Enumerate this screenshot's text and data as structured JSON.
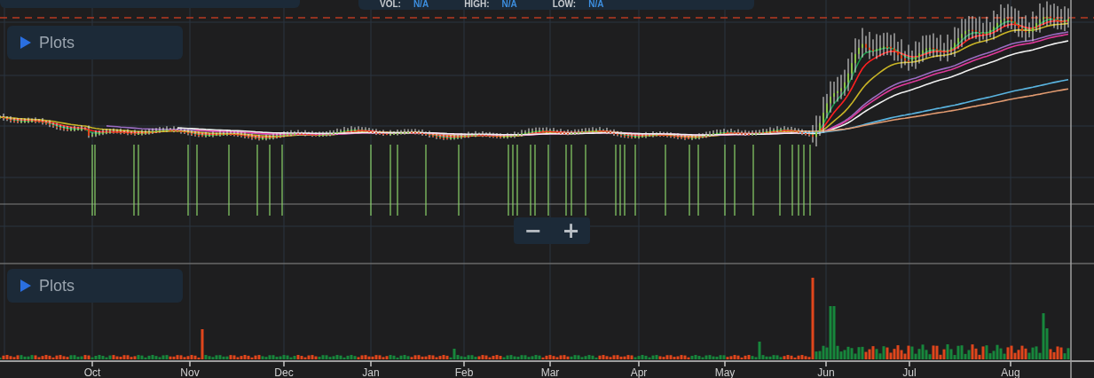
{
  "header": {
    "stats": [
      {
        "label": "VOL:",
        "value": "N/A"
      },
      {
        "label": "HIGH:",
        "value": "N/A"
      },
      {
        "label": "LOW:",
        "value": "N/A"
      }
    ]
  },
  "price_panel": {
    "plots_button": {
      "label": "Plots"
    },
    "zoom_controls": [
      {
        "label": "−"
      },
      {
        "label": "+"
      }
    ]
  },
  "volume_panel": {
    "plots_button": {
      "label": "Plots"
    }
  },
  "x_axis": {
    "labels": [
      "Oct",
      "Nov",
      "Dec",
      "Jan",
      "Feb",
      "Mar",
      "Apr",
      "May",
      "Jun",
      "Jul",
      "Aug"
    ]
  }
}
